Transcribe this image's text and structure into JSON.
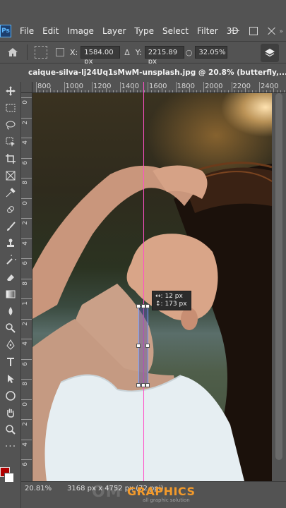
{
  "app": {
    "logo_text": "Ps"
  },
  "menu": [
    "File",
    "Edit",
    "Image",
    "Layer",
    "Type",
    "Select",
    "Filter",
    "3D"
  ],
  "options": {
    "x_label": "X:",
    "x_value": "1584.00 px",
    "y_label": "Y:",
    "y_value": "2215.89 px",
    "zoom_value": "32.05%"
  },
  "document": {
    "tab_title": "caique-silva-lj24Uq1sMwM-unsplash.jpg @ 20.8% (butterfly,..."
  },
  "ruler": {
    "h_labels": [
      "800",
      "1000",
      "1200",
      "1400",
      "1600",
      "1800",
      "2000",
      "2200",
      "2400"
    ],
    "v_labels": [
      "0",
      "2",
      "4",
      "6",
      "8",
      "0",
      "2",
      "4",
      "6",
      "8",
      "1",
      "2",
      "4",
      "6",
      "8",
      "0",
      "2",
      "4",
      "6"
    ]
  },
  "measure": {
    "width": "12 px",
    "height": "173 px"
  },
  "status": {
    "zoom": "20.81%",
    "doc_size": "3168 px x 4752 px (72 ppi)"
  },
  "watermark": {
    "text": "OM",
    "brand": "GRAPHICS",
    "sub": "all graphic solution"
  },
  "colors": {
    "foreground": "#b00000",
    "background": "#ffffff",
    "guide": "#ff4fc7"
  }
}
